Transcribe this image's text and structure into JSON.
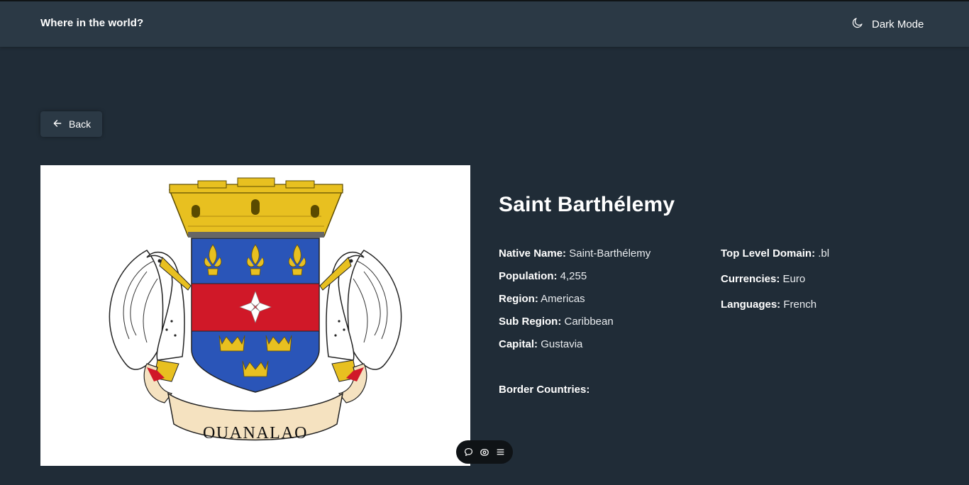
{
  "header": {
    "title": "Where in the world?",
    "theme_toggle_label": "Dark Mode",
    "theme_icon": "moon-icon"
  },
  "back_button": {
    "label": "Back",
    "icon": "arrow-left-icon"
  },
  "country": {
    "name": "Saint Barthélemy",
    "flag_motto": "OUANALAO",
    "details_left": [
      {
        "label": "Native Name:",
        "value": "Saint-Barthélemy"
      },
      {
        "label": "Population:",
        "value": "4,255"
      },
      {
        "label": "Region:",
        "value": "Americas"
      },
      {
        "label": "Sub Region:",
        "value": "Caribbean"
      },
      {
        "label": "Capital:",
        "value": "Gustavia"
      }
    ],
    "details_right": [
      {
        "label": "Top Level Domain:",
        "value": ".bl"
      },
      {
        "label": "Currencies:",
        "value": "Euro"
      },
      {
        "label": "Languages:",
        "value": "French"
      }
    ],
    "border_countries_label": "Border Countries:"
  },
  "floating_toolbar": {
    "icons": [
      "comment-icon",
      "eye-icon",
      "menu-icon"
    ]
  },
  "colors": {
    "background": "#202c37",
    "element": "#2b3945",
    "text": "#ffffff"
  }
}
